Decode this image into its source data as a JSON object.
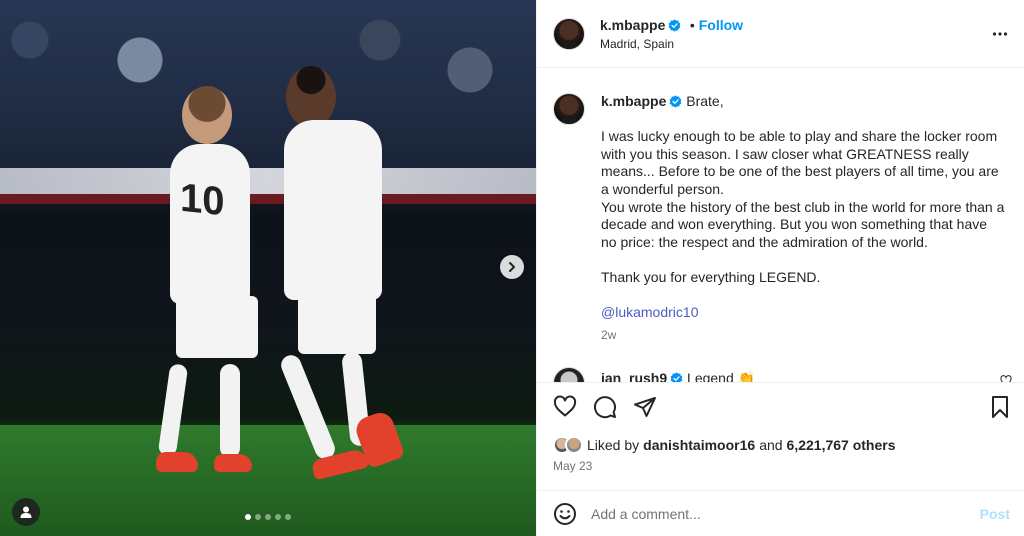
{
  "post": {
    "author": "k.mbappe",
    "location": "Madrid, Spain",
    "follow_label": "Follow",
    "more_icon": "more-horizontal-icon"
  },
  "caption": {
    "username": "k.mbappe",
    "lines": [
      "Brate,",
      "",
      "I was lucky enough to be able to play and share the locker room with you this season. I saw closer what GREATNESS really means... Before to be one of the best players of all time, you are a wonderful person.",
      "You wrote the history of the best club in the world for more than a decade and won everything. But you won something that have no price: the respect and the admiration of the world.",
      "",
      "Thank you for everything LEGEND.",
      "",
      "@lukamodric10"
    ],
    "time": "2w"
  },
  "comment": {
    "username": "ian_rush9",
    "text": "Legend 👏"
  },
  "likes": {
    "prefix": "Liked by",
    "user": "danishtaimoor16",
    "and": "and",
    "count": "6,221,767 others"
  },
  "date": "May 23",
  "comment_box": {
    "placeholder": "Add a comment...",
    "post_label": "Post"
  },
  "media": {
    "shirt_numbers": [
      "10"
    ],
    "carousel_count": 5,
    "carousel_active": 1
  },
  "colors": {
    "follow": "#0095f6",
    "post_disabled": "#b2dffc",
    "verified": "#0095f6"
  }
}
